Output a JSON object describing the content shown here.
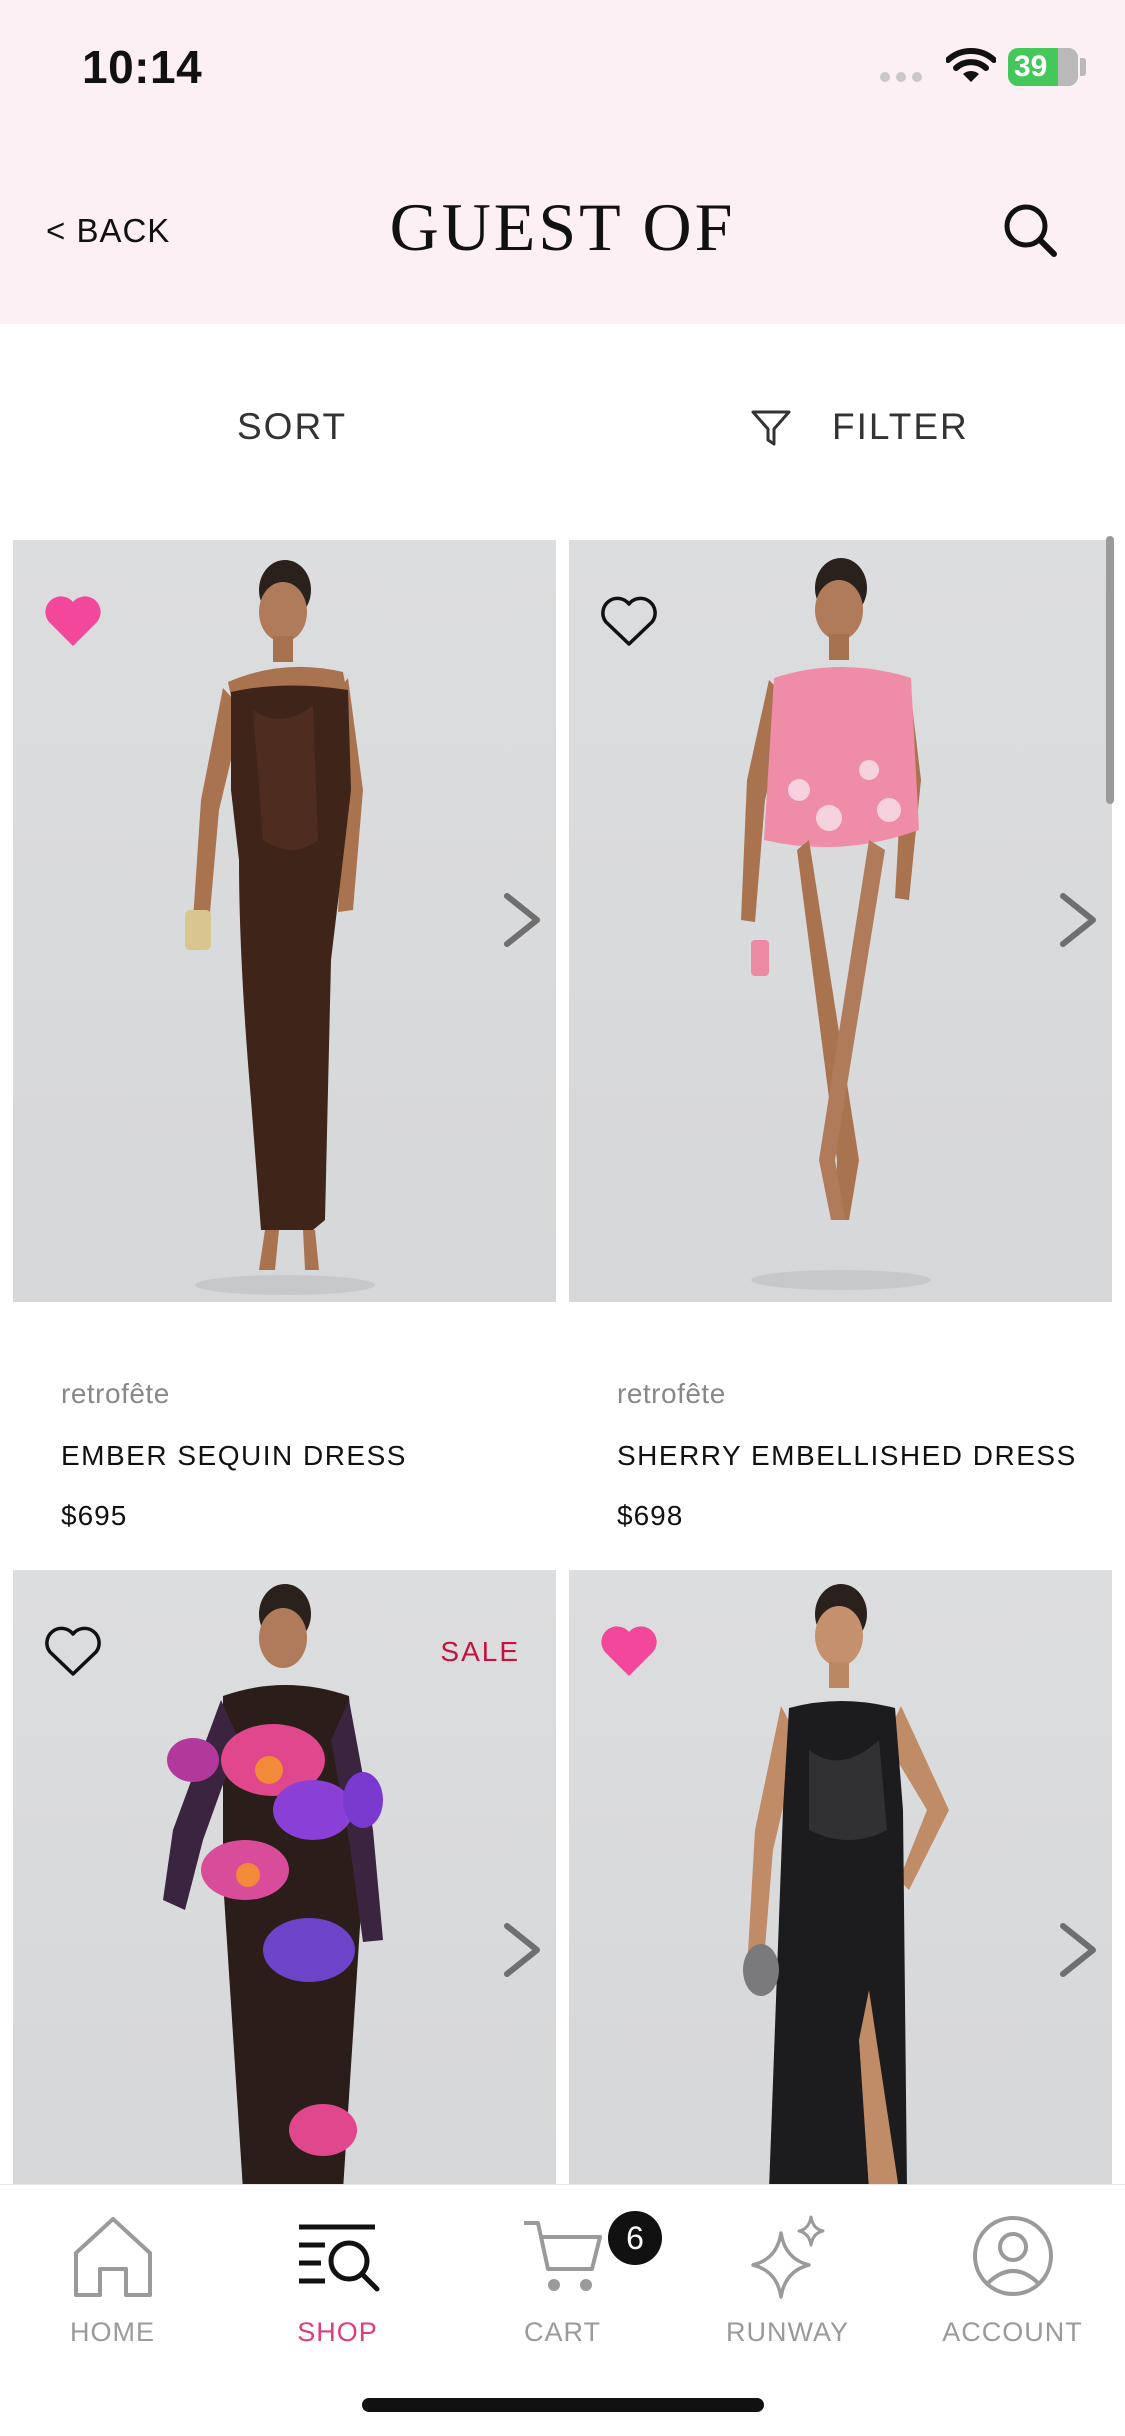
{
  "status_bar": {
    "time": "10:14",
    "battery": "39"
  },
  "header": {
    "back_label": "< BACK",
    "title": "GUEST OF"
  },
  "toolbar": {
    "sort_label": "SORT",
    "filter_label": "FILTER"
  },
  "products": [
    {
      "brand": "retrofête",
      "name": "EMBER SEQUIN DRESS",
      "price": "$695",
      "favorited": true,
      "sale_label": ""
    },
    {
      "brand": "retrofête",
      "name": "SHERRY EMBELLISHED DRESS",
      "price": "$698",
      "favorited": false,
      "sale_label": ""
    },
    {
      "brand": "",
      "name": "",
      "price": "",
      "favorited": false,
      "sale_label": "SALE"
    },
    {
      "brand": "",
      "name": "",
      "price": "",
      "favorited": true,
      "sale_label": ""
    }
  ],
  "tabs": [
    {
      "label": "HOME",
      "icon": "home-icon",
      "active": false
    },
    {
      "label": "SHOP",
      "icon": "shop-search-icon",
      "active": true
    },
    {
      "label": "CART",
      "icon": "cart-icon",
      "active": false,
      "badge": "6"
    },
    {
      "label": "RUNWAY",
      "icon": "sparkle-icon",
      "active": false
    },
    {
      "label": "ACCOUNT",
      "icon": "account-icon",
      "active": false
    }
  ],
  "colors": {
    "header_bg": "#fdf0f4",
    "accent_pink": "#e23b7e",
    "heart_pink": "#f2479a",
    "sale_red": "#c6113f"
  }
}
